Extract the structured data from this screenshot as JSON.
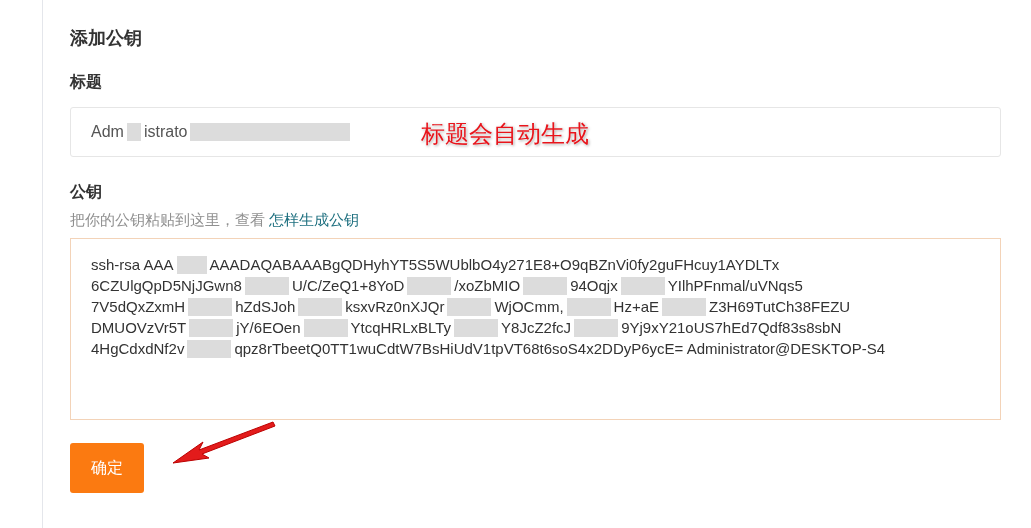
{
  "heading": "添加公钥",
  "title_field": {
    "label": "标题",
    "value_parts": [
      "Adm",
      "istrato"
    ],
    "annotation": "标题会自动生成"
  },
  "key_field": {
    "label": "公钥",
    "hint": "把你的公钥粘贴到这里，查看",
    "hint_link": "怎样生成公钥",
    "lines": [
      [
        "ssh-rsa AAA",
        "AAADAQABAAABgQDHyhYT5S5WUblbO4y271E8+O9qBZnVi0fy2guFHcuy1AYDLTx"
      ],
      [
        "6CZUlgQpD5NjJGwn8",
        "U/C/ZeQ1+8YoD",
        "/xoZbMIO",
        "94Oqjx",
        "YIlhPFnmal/uVNqs5"
      ],
      [
        "7V5dQxZxmH",
        "hZdSJoh",
        "ksxvRz0nXJQr",
        "WjOCmm,",
        "Hz+aE",
        "Z3H69TutCh38FEZU"
      ],
      [
        "DMUOVzVr5T",
        "jY/6EOen",
        "YtcqHRLxBLTy",
        "Y8JcZ2fcJ",
        "9Yj9xY21oUS7hEd7Qdf83s8sbN"
      ],
      [
        "4HgCdxdNf2v",
        "qpz8rTbeetQ0TT1wuCdtW7BsHiUdV1tpVT68t6soS4x2DDyP6ycE= Administrator@DESKTOP-S4"
      ]
    ]
  },
  "submit_button": "确定"
}
